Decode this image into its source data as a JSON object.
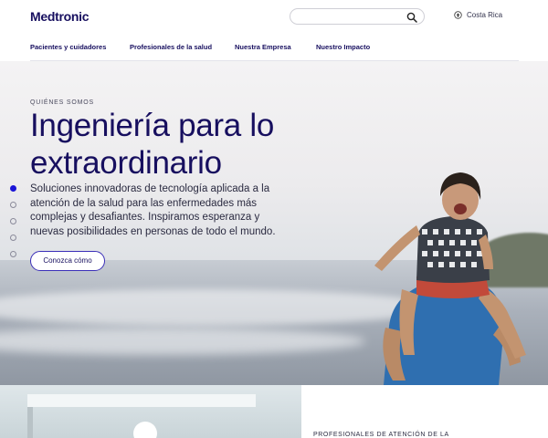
{
  "brand": {
    "logo_text": "Medtronic"
  },
  "search": {
    "placeholder": ""
  },
  "country": {
    "label": "Costa Rica",
    "icon": "location-icon"
  },
  "nav": {
    "items": [
      {
        "label": "Pacientes y cuidadores"
      },
      {
        "label": "Profesionales de la salud"
      },
      {
        "label": "Nuestra Empresa"
      },
      {
        "label": "Nuestro Impacto"
      }
    ]
  },
  "hero": {
    "eyebrow": "QUIÉNES SOMOS",
    "headline_line1": "Ingeniería para lo",
    "headline_line2": "extraordinario",
    "description": "Soluciones innovadoras de tecnología aplicada a la atención de la salud para las enfermedades más complejas y desafiantes. Inspiramos esperanza y nuevas posibilidades en personas de todo el mundo.",
    "cta_label": "Conozca cómo",
    "carousel": {
      "slides": 5,
      "active_index": 0
    }
  },
  "next_section": {
    "eyebrow": "PROFESIONALES DE ATENCIÓN DE LA"
  },
  "colors": {
    "brand": "#170f5f",
    "accent": "#1a14d6"
  }
}
